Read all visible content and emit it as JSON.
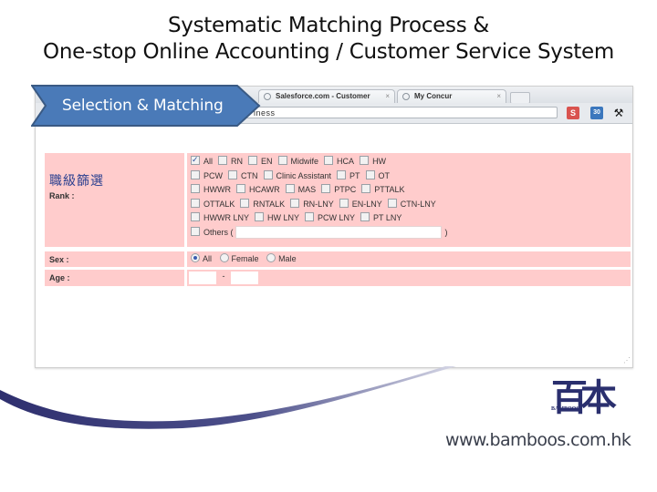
{
  "slide": {
    "title_line1": "Systematic Matching Process &",
    "title_line2": "One-stop Online Accounting / Customer Service System",
    "callout_label": "Selection & Matching",
    "website": "www.bamboos.com.hk",
    "logo_text": "BAMBOOS",
    "logo_glyph": "百本",
    "colors": {
      "callout_fill": "#4a7ab8",
      "callout_border": "#3a5a84",
      "row_bg": "#ffcccc",
      "swoosh": "#2e2f6e",
      "logo": "#2a2f6e"
    }
  },
  "browser": {
    "tabs": [
      {
        "label": "Salesforce.com - Customer",
        "close": "×"
      },
      {
        "label": "My Concur",
        "close": "×"
      }
    ],
    "url_fragment": "iness",
    "toolbar_icons": [
      "salesforce-icon",
      "calendar-icon",
      "wrench-icon"
    ],
    "icon_glyphs": {
      "salesforce": "S",
      "calendar": "30",
      "wrench": "🔧"
    }
  },
  "form": {
    "rank": {
      "label_zh": "職級篩選",
      "label_en": "Rank :",
      "lines": [
        [
          {
            "label": "All",
            "checked": true
          },
          {
            "label": "RN",
            "checked": false
          },
          {
            "label": "EN",
            "checked": false
          },
          {
            "label": "Midwife",
            "checked": false
          },
          {
            "label": "HCA",
            "checked": false
          },
          {
            "label": "HW",
            "checked": false
          }
        ],
        [
          {
            "label": "PCW",
            "checked": false
          },
          {
            "label": "CTN",
            "checked": false
          },
          {
            "label": "Clinic Assistant",
            "checked": false
          },
          {
            "label": "PT",
            "checked": false
          },
          {
            "label": "OT",
            "checked": false
          }
        ],
        [
          {
            "label": "HWWR",
            "checked": false
          },
          {
            "label": "HCAWR",
            "checked": false
          },
          {
            "label": "MAS",
            "checked": false
          },
          {
            "label": "PTPC",
            "checked": false
          },
          {
            "label": "PTTALK",
            "checked": false
          }
        ],
        [
          {
            "label": "OTTALK",
            "checked": false
          },
          {
            "label": "RNTALK",
            "checked": false
          },
          {
            "label": "RN-LNY",
            "checked": false
          },
          {
            "label": "EN-LNY",
            "checked": false
          },
          {
            "label": "CTN-LNY",
            "checked": false
          }
        ],
        [
          {
            "label": "HWWR LNY",
            "checked": false
          },
          {
            "label": "HW LNY",
            "checked": false
          },
          {
            "label": "PCW LNY",
            "checked": false
          },
          {
            "label": "PT LNY",
            "checked": false
          }
        ]
      ],
      "others_label": "Others (",
      "others_close": ")",
      "others_value": ""
    },
    "sex": {
      "label": "Sex :",
      "options": [
        {
          "label": "All",
          "checked": true
        },
        {
          "label": "Female",
          "checked": false
        },
        {
          "label": "Male",
          "checked": false
        }
      ]
    },
    "age": {
      "label": "Age :",
      "from_value": "",
      "to_value": "",
      "separator": "-"
    }
  }
}
